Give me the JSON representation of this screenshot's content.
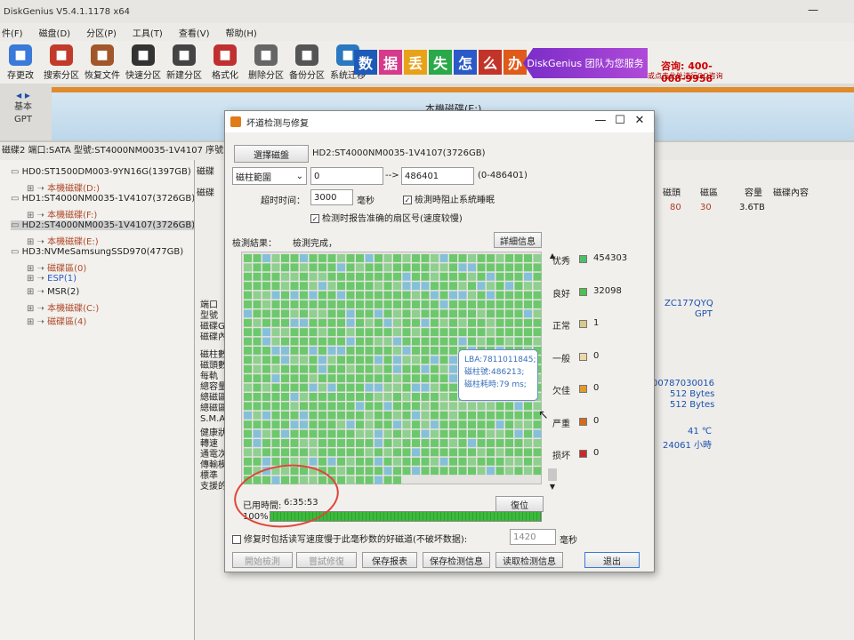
{
  "app": {
    "title": "DiskGenius V5.4.1.1178 x64"
  },
  "menu": [
    "件(F)",
    "磁盘(D)",
    "分区(P)",
    "工具(T)",
    "查看(V)",
    "帮助(H)"
  ],
  "toolbar": [
    {
      "label": "存更改",
      "icon": "save-icon",
      "color": "#3a7ad8"
    },
    {
      "label": "搜索分区",
      "icon": "search-icon",
      "color": "#c23a2a"
    },
    {
      "label": "恢复文件",
      "icon": "recover-icon",
      "color": "#a2572a"
    },
    {
      "label": "快速分区",
      "icon": "quick-partition-icon",
      "color": "#333333"
    },
    {
      "label": "新建分区",
      "icon": "new-partition-icon",
      "color": "#444444"
    },
    {
      "label": "格式化",
      "icon": "format-icon",
      "color": "#c03030"
    },
    {
      "label": "删除分区",
      "icon": "delete-icon",
      "color": "#666666"
    },
    {
      "label": "备份分区",
      "icon": "backup-icon",
      "color": "#555555"
    },
    {
      "label": "系统迁移",
      "icon": "migrate-icon",
      "color": "#2a78c0"
    }
  ],
  "banner": {
    "chars": [
      "数",
      "据",
      "丢",
      "失",
      "怎",
      "么",
      "办"
    ],
    "char_colors": [
      "#1e5ab8",
      "#d63a8a",
      "#e8a21a",
      "#2aa84a",
      "#2a5ac8",
      "#c2342a",
      "#e05a1a"
    ],
    "promo": "DiskGenius 团队为您服务",
    "phone": "400-008-9958",
    "phone_label": "咨询:",
    "sub": "或点击此处进行QQ咨询"
  },
  "disk_panel": {
    "left_line1": "基本",
    "left_line2": "GPT",
    "band_label": "本機磁碟(E:)"
  },
  "disk_info": "磁碟2 端口:SATA  型號:ST4000NM0035-1V4107  序號:ZC177QYQ",
  "tree": [
    {
      "label": "HD0:ST1500DM003-9YN16G(1397GB)",
      "type": "disk"
    },
    {
      "label": "本機磁碟(D:)",
      "type": "part-red"
    },
    {
      "label": "HD1:ST4000NM0035-1V4107(3726GB)",
      "type": "disk"
    },
    {
      "label": "本機磁碟(F:)",
      "type": "part-red"
    },
    {
      "label": "HD2:ST4000NM0035-1V4107(3726GB)",
      "type": "disk-selected"
    },
    {
      "label": "本機磁碟(E:)",
      "type": "part-red"
    },
    {
      "label": "HD3:NVMeSamsungSSD970(477GB)",
      "type": "disk"
    },
    {
      "label": "磁碟區(0)",
      "type": "part-red"
    },
    {
      "label": "ESP(1)",
      "type": "part-blue"
    },
    {
      "label": "MSR(2)",
      "type": "part"
    },
    {
      "label": "本機磁碟(C:)",
      "type": "part-red"
    },
    {
      "label": "磁碟區(4)",
      "type": "part-red"
    }
  ],
  "right_pane": {
    "col_headers": [
      "磁頭",
      "磁區",
      "容量",
      "磁碟內容"
    ],
    "row_values": [
      "80",
      "30",
      "3.6TB"
    ],
    "left_labels": [
      "磁碟",
      "磁碟",
      "端口",
      "型號",
      "磁碟G",
      "磁碟內",
      "磁柱數",
      "磁頭數",
      "每軌",
      "總容量",
      "總磁區",
      "總磁區",
      "S.M.A",
      "健康狀",
      "轉速",
      "通電次",
      "傳輸模",
      "標準",
      "支援的"
    ],
    "values": {
      "serial": "ZC177QYQ",
      "style": "GPT",
      "sectors": "00787030016",
      "sector_size1": "512 Bytes",
      "sector_size2": "512 Bytes",
      "temp": "41 ℃",
      "hours": "24061 小時"
    }
  },
  "dialog": {
    "title": "坏道检测与修复",
    "select_disk_button": "選擇磁盤",
    "disk_name": "HD2:ST4000NM0035-1V4107(3726GB)",
    "range_type": "磁柱範圍",
    "range_start": "0",
    "arrow": "-->",
    "range_end": "486401",
    "range_hint": "(0-486401)",
    "timeout_label": "超时时间：",
    "timeout_value": "3000",
    "timeout_unit": "毫秒",
    "chk_stop_sleep": "檢測時阻止系統睡眠",
    "chk_report": "检测时报告准确的扇区号(速度较慢)",
    "result_label": "檢測結果：",
    "result_status": "檢測完成，",
    "details_button": "詳細信息",
    "tooltip": [
      "LBA:7811011845;",
      "磁柱號:486213;",
      "磁柱耗時:79 ms;"
    ],
    "legend": [
      {
        "name": "优秀",
        "color": "#4cbf6a",
        "count": "454303"
      },
      {
        "name": "良好",
        "color": "#4ec04e",
        "count": "32098"
      },
      {
        "name": "正常",
        "color": "#d9c98a",
        "count": "1"
      },
      {
        "name": "一般",
        "color": "#ecd9a8",
        "count": "0"
      },
      {
        "name": "欠佳",
        "color": "#e09a2a",
        "count": "0"
      },
      {
        "name": "严重",
        "color": "#d46a1a",
        "count": "0"
      },
      {
        "name": "损坏",
        "color": "#c82a2a",
        "count": "0"
      }
    ],
    "elapsed_label": "已用時間:",
    "elapsed_value": "6:35:53",
    "reset_button": "復位",
    "progress_label": "100%",
    "progress_fraction": 1.0,
    "repair_chk": "修复时包括读写速度慢于此毫秒数的好磁道(不破坏数据):",
    "repair_ms": "1420",
    "repair_unit": "毫秒",
    "buttons": {
      "start": "開始檢測",
      "try_repair": "嘗試修復",
      "save_report": "保存报表",
      "save_result": "保存检测信息",
      "load_result": "读取检测信息",
      "exit": "退出"
    },
    "grid_cell_colors": [
      "#6cc86c",
      "#8fcf8f",
      "#85c0d8"
    ]
  }
}
